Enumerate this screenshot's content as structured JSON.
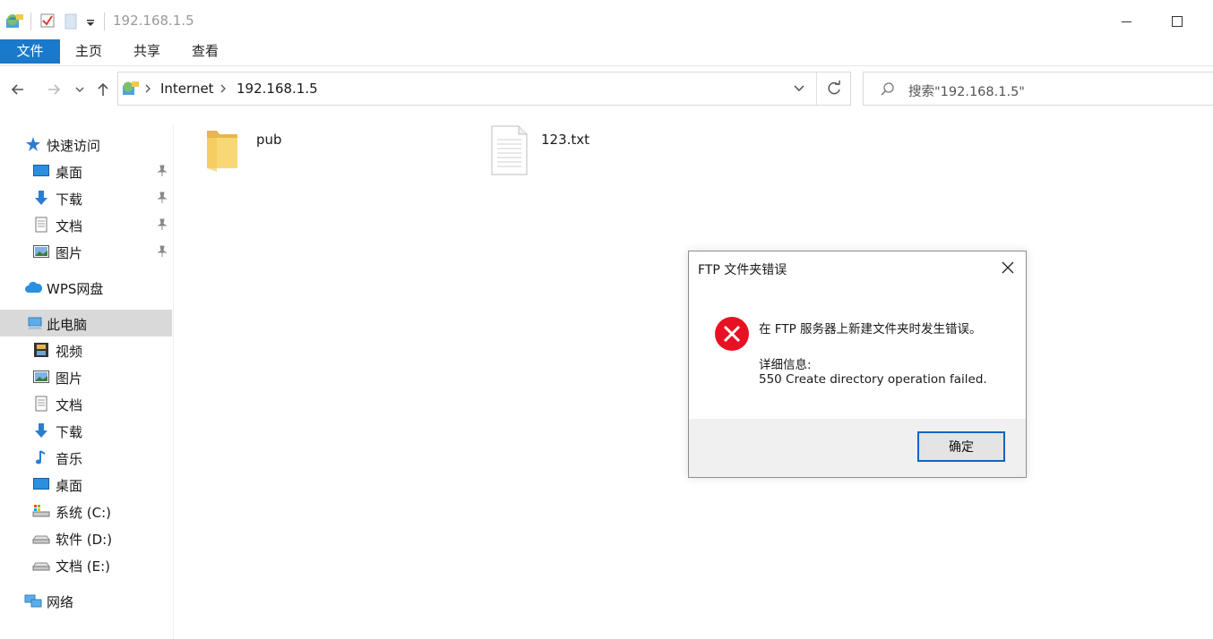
{
  "window": {
    "title": "192.168.1.5"
  },
  "ribbon": {
    "tabs": [
      "文件",
      "主页",
      "共享",
      "查看"
    ]
  },
  "address": {
    "crumbs": [
      "Internet",
      "192.168.1.5"
    ],
    "search_placeholder": "搜索\"192.168.1.5\""
  },
  "sidebar": {
    "quick_access": "快速访问",
    "quick_items": [
      "桌面",
      "下载",
      "文档",
      "图片"
    ],
    "wps": "WPS网盘",
    "this_pc": "此电脑",
    "pc_items": [
      "视频",
      "图片",
      "文档",
      "下载",
      "音乐",
      "桌面",
      "系统 (C:)",
      "软件 (D:)",
      "文档 (E:)"
    ],
    "network": "网络"
  },
  "files": [
    {
      "name": "pub",
      "type": "folder"
    },
    {
      "name": "123.txt",
      "type": "text-file"
    }
  ],
  "dialog": {
    "title": "FTP 文件夹错误",
    "message": "在 FTP 服务器上新建文件夹时发生错误。",
    "details_label": "详细信息:",
    "details": "550 Create directory operation failed.",
    "ok_label": "确定"
  },
  "colors": {
    "accent": "#1979ca",
    "error": "#e81123",
    "selected_row": "#d9d9d9"
  }
}
